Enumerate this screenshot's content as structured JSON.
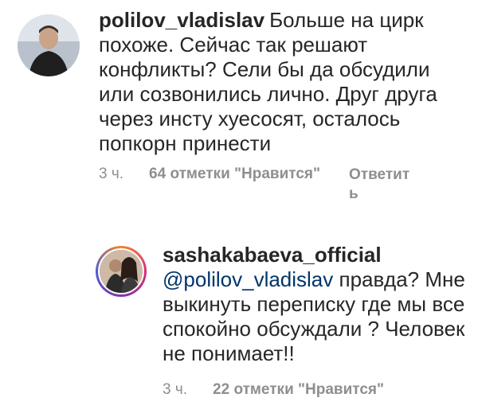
{
  "comments": [
    {
      "username": "polilov_vladislav",
      "text": "Больше на цирк похоже. Сейчас так решают конфликты? Сели бы да обсудили или созвонились лично. Друг друга через инсту хуесосят, осталось попкорн принести",
      "time": "3 ч.",
      "likes": "64 отметки \"Нравится\"",
      "reply": "Ответить"
    },
    {
      "username": "sashakabaeva_official",
      "mention": "@polilov_vladislav",
      "text": "правда? Мне выкинуть переписку где мы все спокойно обсуждали ? Человек не понимает!!",
      "time": "3 ч.",
      "likes": "22 отметки \"Нравится\""
    }
  ]
}
